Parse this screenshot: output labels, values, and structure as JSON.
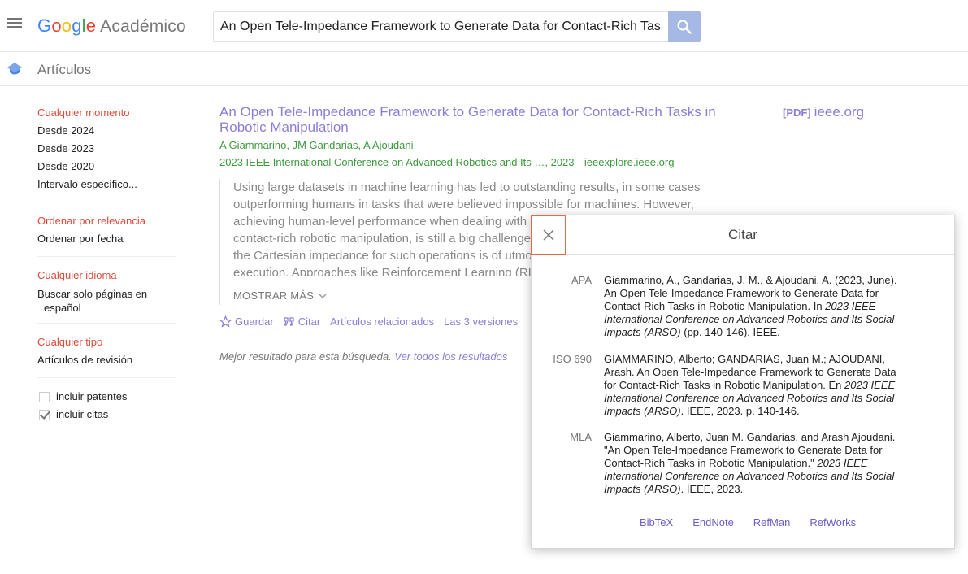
{
  "brand": {
    "google": "Google",
    "product": "Académico"
  },
  "search": {
    "query": "An Open Tele-Impedance Framework to Generate Data for Contact-Rich Tasks in Robotic Manipulation"
  },
  "subheader": {
    "title": "Artículos"
  },
  "sidebar": {
    "time": [
      "Cualquier momento",
      "Desde 2024",
      "Desde 2023",
      "Desde 2020",
      "Intervalo específico..."
    ],
    "sort": [
      "Ordenar por relevancia",
      "Ordenar por fecha"
    ],
    "lang_title": "Cualquier idioma",
    "lang_item_1": "Buscar solo páginas en",
    "lang_item_2": "español",
    "type": [
      "Cualquier tipo",
      "Artículos de revisión"
    ],
    "checks": [
      {
        "label": "incluir patentes",
        "checked": false
      },
      {
        "label": "incluir citas",
        "checked": true
      }
    ]
  },
  "result": {
    "title": "An Open Tele-Impedance Framework to Generate Data for Contact-Rich Tasks in Robotic Manipulation",
    "authors": [
      "A Giammarino",
      "JM Gandarias",
      "A Ajoudani"
    ],
    "venue": "2023 IEEE International Conference on Advanced Robotics and Its …, 2023",
    "source": "ieeexplore.ieee.org",
    "abstract": "Using large datasets in machine learning has led to outstanding results, in some cases outperforming humans in tasks that were believed impossible for machines. However, achieving human-level performance when dealing with physically interactive tasks, eg, in contact-rich robotic manipulation, is still a big challenge. It is well known that regulating the Cartesian impedance for such operations is of utmost importance for their successful execution. Approaches like Reinforcement Learning (RL) can be a promising",
    "more": "MOSTRAR MÁS",
    "actions": {
      "save": "Guardar",
      "cite": "Citar",
      "related": "Artículos relacionados",
      "versions": "Las 3 versiones"
    },
    "best_text": "Mejor resultado para esta búsqueda.",
    "best_link": "Ver todos los resultados"
  },
  "pdf": {
    "tag": "[PDF]",
    "domain": "ieee.org"
  },
  "dialog": {
    "title": "Citar",
    "apa_label": "APA",
    "apa_plain": "Giammarino, A., Gandarias, J. M., & Ajoudani, A. (2023, June). An Open Tele-Impedance Framework to Generate Data for Contact-Rich Tasks in Robotic Manipulation. In ",
    "apa_italic": "2023 IEEE International Conference on Advanced Robotics and Its Social Impacts (ARSO)",
    "apa_tail": " (pp. 140-146). IEEE.",
    "iso_label": "ISO 690",
    "iso_plain": "GIAMMARINO, Alberto; GANDARIAS, Juan M.; AJOUDANI, Arash. An Open Tele-Impedance Framework to Generate Data for Contact-Rich Tasks in Robotic Manipulation. En ",
    "iso_italic": "2023 IEEE International Conference on Advanced Robotics and Its Social Impacts (ARSO)",
    "iso_tail": ". IEEE, 2023. p. 140-146.",
    "mla_label": "MLA",
    "mla_plain": "Giammarino, Alberto, Juan M. Gandarias, and Arash Ajoudani. \"An Open Tele-Impedance Framework to Generate Data for Contact-Rich Tasks in Robotic Manipulation.\" ",
    "mla_italic": "2023 IEEE International Conference on Advanced Robotics and Its Social Impacts (ARSO)",
    "mla_tail": ". IEEE, 2023.",
    "links": [
      "BibTeX",
      "EndNote",
      "RefMan",
      "RefWorks"
    ]
  },
  "colors": {
    "link": "#8a7fd8",
    "green": "#3d9a3d",
    "active": "#dd4b39",
    "close_border": "#e06b4b"
  }
}
